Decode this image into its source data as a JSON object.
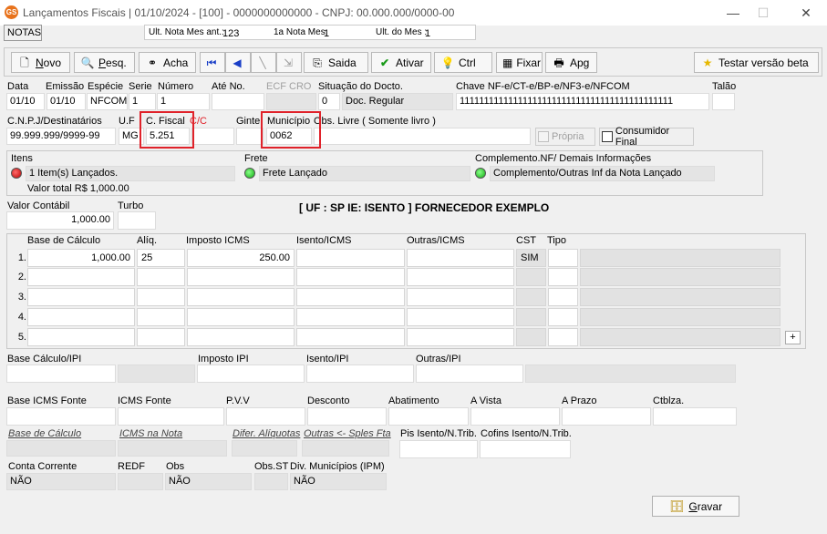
{
  "window": {
    "title": "Lançamentos Fiscais |  01/10/2024 - [100] - 0000000000000 - CNPJ: 00.000.000/0000-00",
    "app_icon": "GS"
  },
  "tab": {
    "label": "NOTAS"
  },
  "info_bar": {
    "ult_nota_label": "Ult. Nota Mes ant.:",
    "ult_nota_value": "123",
    "primeira_nota_label": "1a Nota Mes:",
    "primeira_nota_value": "1",
    "ult_mes_label": "Ult. do Mes :",
    "ult_mes_value": "1"
  },
  "toolbar": {
    "novo": "Novo",
    "pesq": "Pesq.",
    "acha": "Acha",
    "saida": "Saida",
    "ativar": "Ativar",
    "ctrl": "Ctrl",
    "fixar": "Fixar",
    "apg": "Apg",
    "testar": "Testar versão beta"
  },
  "header": {
    "data_label": "Data",
    "data": "01/10",
    "emissao_label": "Emissão",
    "emissao": "01/10",
    "especie_label": "Espécie",
    "especie": "NFCOM",
    "serie_label": "Serie",
    "serie": "1",
    "numero_label": "Número",
    "numero": "1",
    "ate_no_label": "Até No.",
    "ecf_label": "ECF",
    "cro_label": "CRO",
    "situacao_label": "Situação do Docto.",
    "situacao_code": "0",
    "situacao_text": "Doc. Regular",
    "chave_label": "Chave NF-e/CT-e/BP-e/NF3-e/NFCOM",
    "chave": "11111111111111111111111111111111111111111111",
    "talao_label": "Talão"
  },
  "row2": {
    "cnpj_label": "C.N.P.J/Destinatários",
    "cnpj": "99.999.999/9999-99",
    "uf_label": "U.F",
    "uf": "MG",
    "cfiscal_label": "C. Fiscal",
    "cc_label": "C/C",
    "cfiscal": "5.251",
    "ginte_label": "Ginte",
    "municipio_label": "Município",
    "municipio": "0062",
    "obs_livre_label": "Obs. Livre ( Somente livro )",
    "propria_label": "Própria",
    "consumidor_label": "Consumidor Final"
  },
  "itens": {
    "itens_label": "Itens",
    "itens_status": "1 Item(s) Lançados.",
    "valor_total": "Valor total R$ 1,000.00",
    "frete_label": "Frete",
    "frete_status": "Frete Lançado",
    "complemento_label": "Complemento.NF/ Demais Informações",
    "complemento_status": "Complemento/Outras Inf da Nota Lançado"
  },
  "valor": {
    "valor_contabil_label": "Valor Contábil",
    "valor_contabil": "1,000.00",
    "turbo_label": "Turbo",
    "banner": "[ UF : SP IE: ISENTO ] FORNECEDOR EXEMPLO"
  },
  "icms_grid": {
    "headers": [
      "Base de Cálculo",
      "Alíq.",
      "Imposto ICMS",
      "Isento/ICMS",
      "Outras/ICMS",
      "CST",
      "Tipo"
    ],
    "rows": [
      {
        "n": "1.",
        "base": "1,000.00",
        "aliq": "25",
        "imposto": "250.00",
        "isento": "",
        "outras": "",
        "cst": "SIM",
        "tipo": ""
      },
      {
        "n": "2.",
        "base": "",
        "aliq": "",
        "imposto": "",
        "isento": "",
        "outras": "",
        "cst": "",
        "tipo": ""
      },
      {
        "n": "3.",
        "base": "",
        "aliq": "",
        "imposto": "",
        "isento": "",
        "outras": "",
        "cst": "",
        "tipo": ""
      },
      {
        "n": "4.",
        "base": "",
        "aliq": "",
        "imposto": "",
        "isento": "",
        "outras": "",
        "cst": "",
        "tipo": ""
      },
      {
        "n": "5.",
        "base": "",
        "aliq": "",
        "imposto": "",
        "isento": "",
        "outras": "",
        "cst": "",
        "tipo": ""
      }
    ],
    "plus": "+"
  },
  "ipi": {
    "base_label": "Base Cálculo/IPI",
    "imposto_label": "Imposto IPI",
    "isento_label": "Isento/IPI",
    "outras_label": "Outras/IPI"
  },
  "fonte": {
    "base_fonte_label": "Base ICMS Fonte",
    "icms_fonte_label": "ICMS Fonte",
    "pvv_label": "P.V.V",
    "desconto_label": "Desconto",
    "abatimento_label": "Abatimento",
    "a_vista_label": "A Vista",
    "a_prazo_label": "A Prazo",
    "ctblza_label": "Ctblza."
  },
  "italic_row": {
    "base_calculo_label": "Base de Cálculo",
    "icms_nota_label": "ICMS na Nota",
    "difer_label": "Difer. Alíquotas",
    "outras_sples_label": "Outras <- Sples Fta",
    "pis_label": "Pis Isento/N.Trib.",
    "cofins_label": "Cofins Isento/N.Trib."
  },
  "bottom": {
    "conta_corrente_label": "Conta Corrente",
    "conta_corrente": "NÃO",
    "redf_label": "REDF",
    "obs_label": "Obs",
    "obs": "NÃO",
    "obs_st_label": "Obs.ST",
    "div_municipios_label": "Div. Municípios (IPM)",
    "div_municipios": "NÃO",
    "gravar": "Gravar"
  },
  "colors": {
    "highlight_red": "#e0222a",
    "led_red": "#d11",
    "led_green": "#2a2"
  }
}
